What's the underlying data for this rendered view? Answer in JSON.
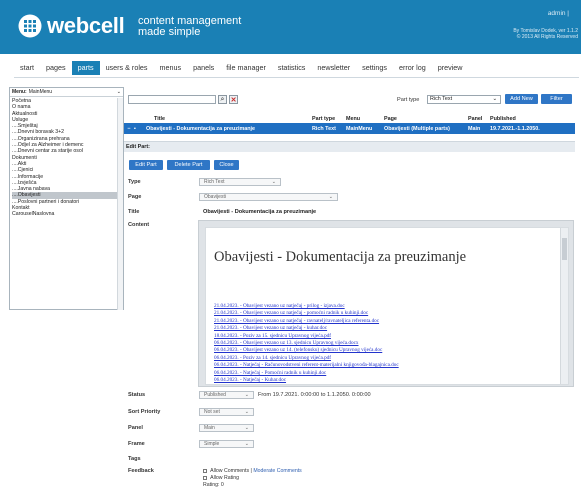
{
  "header": {
    "brand": "webcell",
    "tagline_line1": "content management",
    "tagline_line2": "made simple",
    "admin": "admin |",
    "copyright_line1": "By Tomislav Dodek, ver 1.1.2",
    "copyright_line2": "© 2013 All Rights Reserved",
    "colors": {
      "header_bg": "#1a80b5",
      "accent": "#2f76c6",
      "selected_row": "#1f6fc2"
    }
  },
  "nav": {
    "items": [
      {
        "label": "start"
      },
      {
        "label": "pages"
      },
      {
        "label": "parts",
        "active": true
      },
      {
        "label": "users & roles"
      },
      {
        "label": "menus"
      },
      {
        "label": "panels"
      },
      {
        "label": "file manager"
      },
      {
        "label": "statistics"
      },
      {
        "label": "newsletter"
      },
      {
        "label": "settings"
      },
      {
        "label": "error log"
      },
      {
        "label": "preview"
      }
    ]
  },
  "sidebar": {
    "menu_label": "Menu:",
    "menu_value": "MainMenu",
    "items": [
      "Početna",
      "O nama",
      "Aktualnosti",
      "Usluge",
      "....Smještaj",
      "....Dnevni boravak 3+2",
      "....Organizirana prehrana",
      "....Odjel za Alzheimer i demenc",
      "....Dnevni centar za starije osol",
      "Dokumenti",
      "....Akti",
      "....Cjenici",
      "....Informacije",
      "....Izvješća",
      "....Javna nabava",
      "....Obavijesti",
      "....Poslovni partneri i donatori",
      "Kontakt",
      "CarouselNaslovna"
    ],
    "selected": "....Obavijesti"
  },
  "filter": {
    "search_value": "",
    "part_type_label": "Part type",
    "part_type_value": "Rich Text",
    "add_new": "Add New",
    "filter": "Filter"
  },
  "table": {
    "headers": {
      "title": "Title",
      "part_type": "Part type",
      "menu": "Menu",
      "page": "Page",
      "panel": "Panel",
      "published": "Published"
    },
    "row": {
      "title": "Obavijesti - Dokumentacija za preuzimanje",
      "part_type": "Rich Text",
      "menu": "MainMenu",
      "page": "Obavijesti (Multiple parts)",
      "panel": "Main",
      "published": "19.7.2021.-1.1.2050."
    }
  },
  "edit": {
    "bar_label": "Edit Part:",
    "edit_part": "Edit Part",
    "delete_part": "Delete Part",
    "close": "Close",
    "type_label": "Type",
    "type_value": "Rich Text",
    "page_label": "Page",
    "page_value": "Obavijesti",
    "title_label": "Title",
    "title_value": "Obavijesti - Dokumentacija za preuzimanje",
    "content_label": "Content",
    "status_label": "Status",
    "status_value": "Published",
    "status_from": "From  19.7.2021. 0:00:00  to  1.1.2050. 0:00:00",
    "sort_label": "Sort Priority",
    "sort_value": "Not set",
    "panel_label": "Panel",
    "panel_value": "Main",
    "frame_label": "Frame",
    "frame_value": "Simple",
    "tags_label": "Tags",
    "feedback_label": "Feedback",
    "allow_comments": "Allow Comments",
    "moderate_comments": "Moderate Comments",
    "allow_rating": "Allow Rating",
    "rating": "Rating: 0"
  },
  "document": {
    "title": "Obavijesti - Dokumentacija za preuzimanje",
    "links": [
      "21.04.2023. - Obavijest vezano uz natječaj - prilog - izjava.doc",
      "21.04.2023. - Obavijest vezano uz natječaj - pomoćni radnik u kuhinji.doc",
      "21.04.2023. - Obavijest vezano uz natječaj - ravnatelj/ravnateljica referenta.doc",
      "21.04.2023. - Obavijest vezano uz natječaj - kuhar.doc",
      "18.04.2023. - Poziv za 15. sjednicu Upravnog vijeća.pdf",
      "06.04.2023. - Obavijest vezano uz 13. sjednicu Upravnog vijeća.docx",
      "06.04.2023. - Obavijest vezano uz 14. (telefonsku) sjednicu Upravnog vijeća.doc",
      "06.04.2023. - Poziv za 14. sjednicu Upravnog vijeća.pdf",
      "06.04.2023. - Natječaj - Računovodstveni referent-materijalni knjigovođa-blagajnica.doc",
      "06.04.2023. - Natječaj - Pomoćni radnik u kuhinji.doc",
      "06.04.2023. - Natječaj - Kuhar.doc"
    ]
  }
}
